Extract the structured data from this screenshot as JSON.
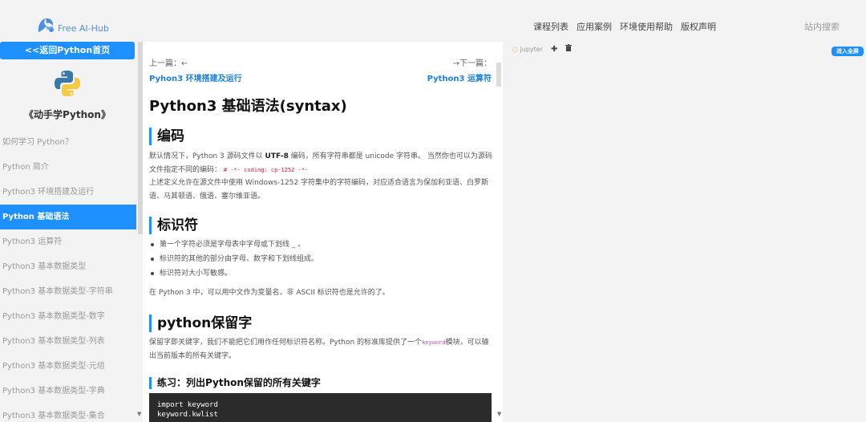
{
  "header": {
    "logo_text": "Free AI-Hub",
    "nav": [
      "课程列表",
      "应用案例",
      "环境使用帮助",
      "版权声明"
    ],
    "search": "站内搜索"
  },
  "sidebar": {
    "back_button": "<<返回Python首页",
    "course_title": "《动手学Python》",
    "items": [
      {
        "label": "如何学习 Python？"
      },
      {
        "label": "Python 简介"
      },
      {
        "label": "Python3 环境搭建及运行"
      },
      {
        "label": "Python 基础语法"
      },
      {
        "label": "Python3 运算符"
      },
      {
        "label": "Python3 基本数据类型"
      },
      {
        "label": "Python3 基本数据类型-字符串"
      },
      {
        "label": "Python3 基本数据类型-数字"
      },
      {
        "label": "Python3 基本数据类型-列表"
      },
      {
        "label": "Python3 基本数据类型-元组"
      },
      {
        "label": "Python3 基本数据类型-字典"
      },
      {
        "label": "Python3 基本数据类型-集合"
      }
    ],
    "active_index": 3
  },
  "article": {
    "prev_label": "上一篇：←",
    "prev_link": "Pyhon3 环境搭建及运行",
    "next_label": "→下一篇：",
    "next_link": "Python3 运算符",
    "title": "Python3 基础语法(syntax)",
    "sec1_title": "编码",
    "sec1_p1_a": "默认情况下，Python 3 源码文件以 ",
    "sec1_p1_bold": "UTF-8",
    "sec1_p1_b": " 编码，所有字符串都是 unicode 字符串。 当然你也可以为源码文件指定不同的编码：",
    "sec1_p1_code": "# -*- coding: cp-1252 -*-",
    "sec1_p2": "上述定义允许在源文件中使用 Windows-1252 字符集中的字符编码，对应适合语言为保加利亚语、白罗斯语、马其顿语、俄语、塞尔维亚语。",
    "sec2_title": "标识符",
    "sec2_bullets": [
      "第一个字符必须是字母表中字母或下划线 _ 。",
      "标识符的其他的部分由字母、数字和下划线组成。",
      "标识符对大小写敏感。"
    ],
    "sec2_p": "在 Python 3 中，可以用中文作为变量名，非 ASCII 标识符也是允许的了。",
    "sec3_title": "python保留字",
    "sec3_p_a": "保留字即关键字，我们不能把它们用作任何标识符名称。Python 的标准库提供了一个",
    "sec3_p_kw": "keyword",
    "sec3_p_b": "模块，可以输出当前版本的所有关键字。",
    "exercise_title": "练习：列出Python保留的所有关键字",
    "code_line1": "import keyword",
    "code_line2": "keyword.kwlist"
  },
  "jupyter": {
    "logo": "jupyter",
    "add_icon": "plus-icon",
    "delete_icon": "trash-icon",
    "enter_full": "进入全屏"
  },
  "colors": {
    "accent": "#1e90ff",
    "link": "#1e7fd8",
    "code_bg": "#2b2b2b"
  }
}
